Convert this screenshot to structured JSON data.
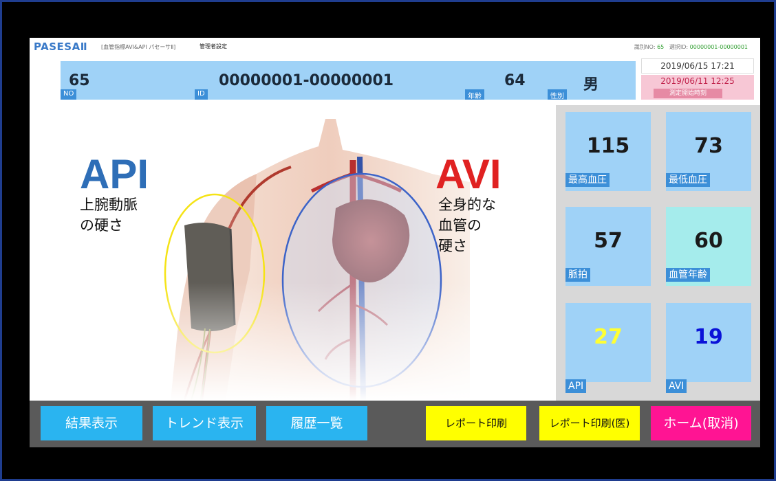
{
  "header": {
    "brand": "PASESAⅡ",
    "subtitle": "[血管指標AVI&API パセーサⅡ]",
    "admin_link": "管理者設定",
    "id_no_label": "識別NO:",
    "id_no_value": "65",
    "select_id_label": "選択ID:",
    "select_id_value": "00000001-00000001"
  },
  "patient": {
    "no_value": "65",
    "no_label": "NO",
    "id_value": "00000001-00000001",
    "id_label": "ID",
    "age_value": "64",
    "age_label": "年齢",
    "sex_value": "男",
    "sex_label": "性別",
    "current_datetime": "2019/06/15 17:21",
    "measure_start_datetime": "2019/06/11 12:25",
    "measure_start_label": "測定開始時刻"
  },
  "illustration": {
    "api_title": "API",
    "api_desc_line1": "上腕動脈",
    "api_desc_line2": "の硬さ",
    "avi_title": "AVI",
    "avi_desc_line1": "全身的な",
    "avi_desc_line2": "血管の",
    "avi_desc_line3": "硬さ",
    "colors": {
      "api": "#2e6eb7",
      "avi": "#e02222"
    }
  },
  "metrics": {
    "systolic": {
      "value": "115",
      "label": "最高血圧"
    },
    "diastolic": {
      "value": "73",
      "label": "最低血圧"
    },
    "pulse": {
      "value": "57",
      "label": "脈拍"
    },
    "vascular_age": {
      "value": "60",
      "label": "血管年齢"
    },
    "api": {
      "value": "27",
      "label": "API",
      "color": "#ffff33"
    },
    "avi": {
      "value": "19",
      "label": "AVI",
      "color": "#0a12d8"
    }
  },
  "buttons": {
    "result": "結果表示",
    "trend": "トレンド表示",
    "history": "履歴一覧",
    "report": "レポート印刷",
    "report_doctor": "レポート印刷(医)",
    "home": "ホーム(取消)"
  }
}
